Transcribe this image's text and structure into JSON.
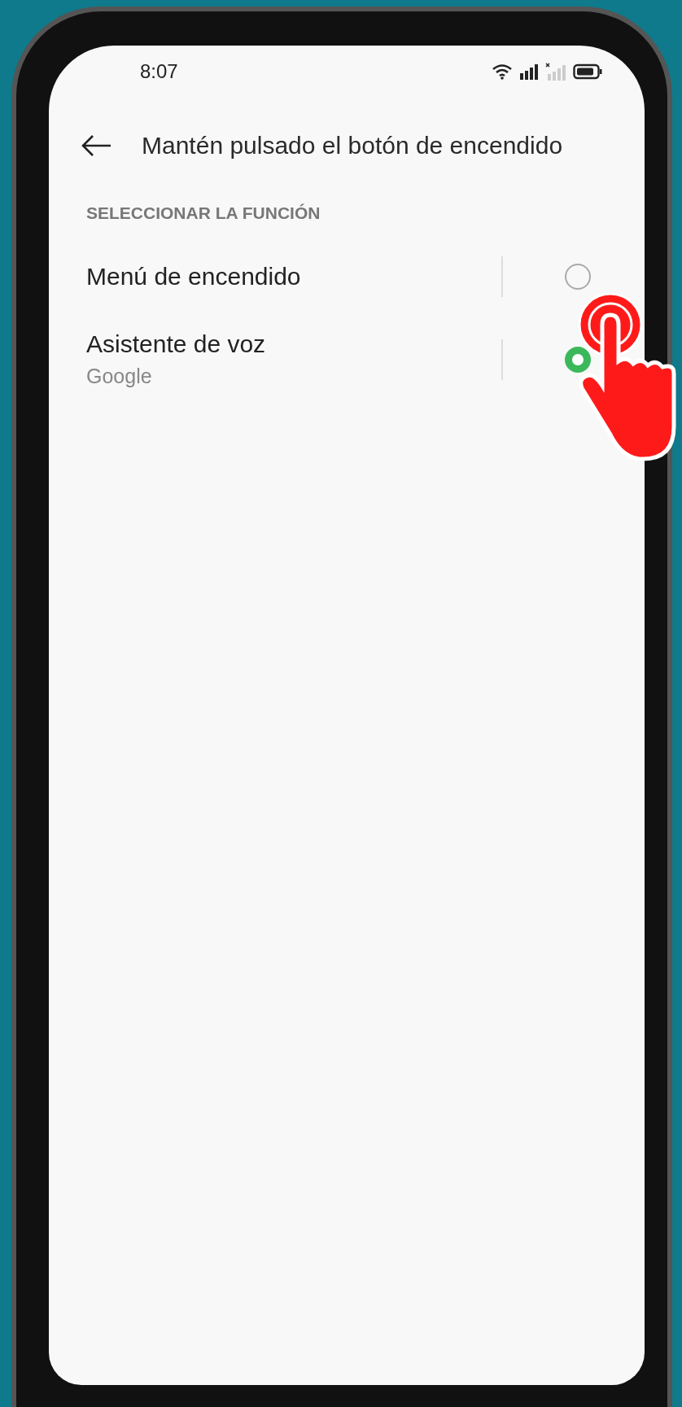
{
  "status_bar": {
    "time": "8:07"
  },
  "header": {
    "title": "Mantén pulsado el botón de encendido"
  },
  "section": {
    "title": "SELECCIONAR LA FUNCIÓN"
  },
  "options": [
    {
      "label": "Menú de encendido",
      "selected": false
    },
    {
      "label": "Asistente de voz",
      "subtitle": "Google",
      "selected": true
    }
  ]
}
